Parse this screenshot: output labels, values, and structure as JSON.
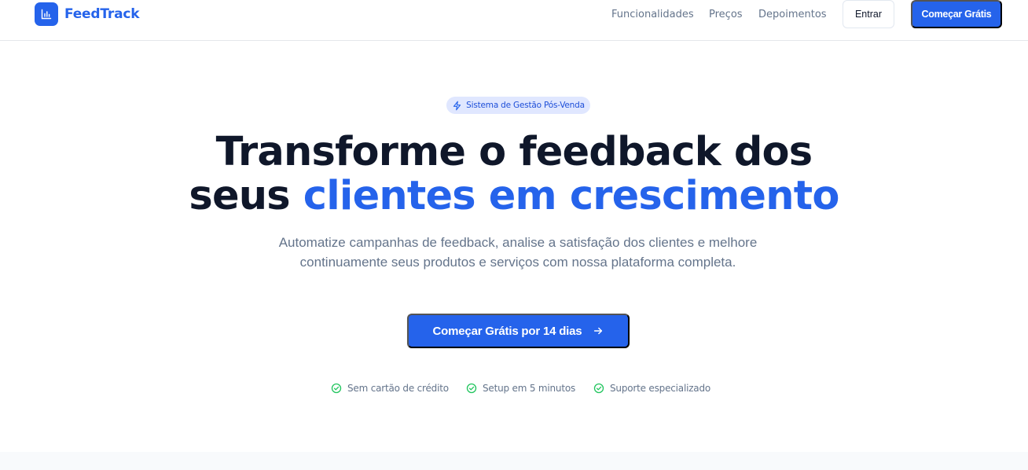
{
  "brand": {
    "name": "FeedTrack",
    "logo_icon": "bar-chart-icon",
    "accent": "#2563eb"
  },
  "nav": {
    "links": [
      "Funcionalidades",
      "Preços",
      "Depoimentos"
    ],
    "login_label": "Entrar",
    "signup_label": "Começar Grátis"
  },
  "hero": {
    "badge": {
      "icon": "lightning-icon",
      "label": "Sistema de Gestão Pós-Venda"
    },
    "headline": {
      "line1": "Transforme o feedback dos",
      "line2_prefix": "seus ",
      "line2_accent": "clientes em crescimento"
    },
    "subtitle": "Automatize campanhas de feedback, analise a satisfação dos clientes e melhore continuamente seus produtos e serviços com nossa plataforma completa.",
    "cta": {
      "label": "Começar Grátis por 14 dias",
      "icon": "arrow-right-icon"
    },
    "features": [
      {
        "icon": "check-circle-icon",
        "label": "Sem cartão de crédito"
      },
      {
        "icon": "check-circle-icon",
        "label": "Setup em 5 minutos"
      },
      {
        "icon": "check-circle-icon",
        "label": "Suporte especializado"
      }
    ]
  },
  "colors": {
    "primary": "#2563eb",
    "heading": "#0f172a",
    "muted": "#64748b",
    "success": "#22c55e",
    "badge_bg": "#e0e7ff"
  }
}
